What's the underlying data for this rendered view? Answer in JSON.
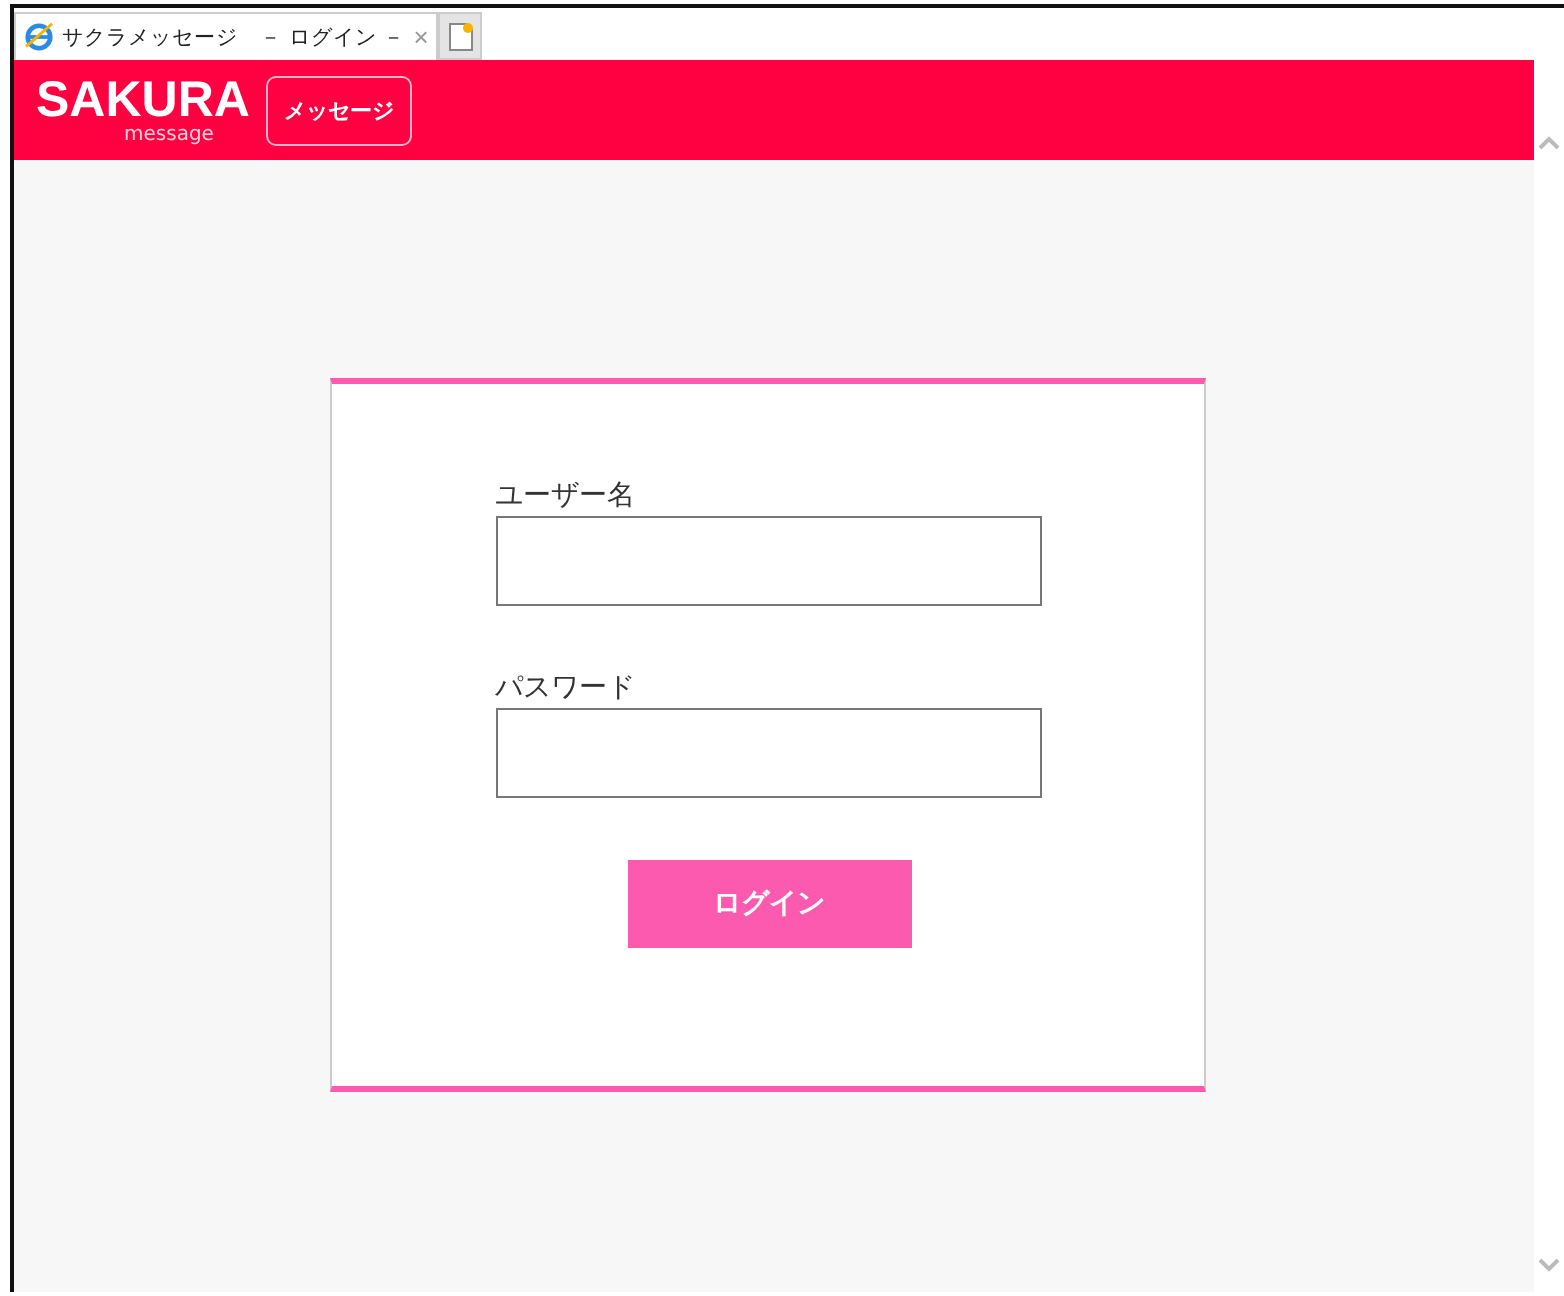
{
  "browser_tab": {
    "title": "サクラメッセージ　－ ログイン －",
    "close": "×"
  },
  "header": {
    "logo": "SAKURA",
    "logo_sub": "message",
    "nav_button": "メッセージ"
  },
  "login_form": {
    "fields": [
      {
        "label": "ユーザー名"
      },
      {
        "label": "パスワード"
      }
    ],
    "submit": "ログイン"
  }
}
